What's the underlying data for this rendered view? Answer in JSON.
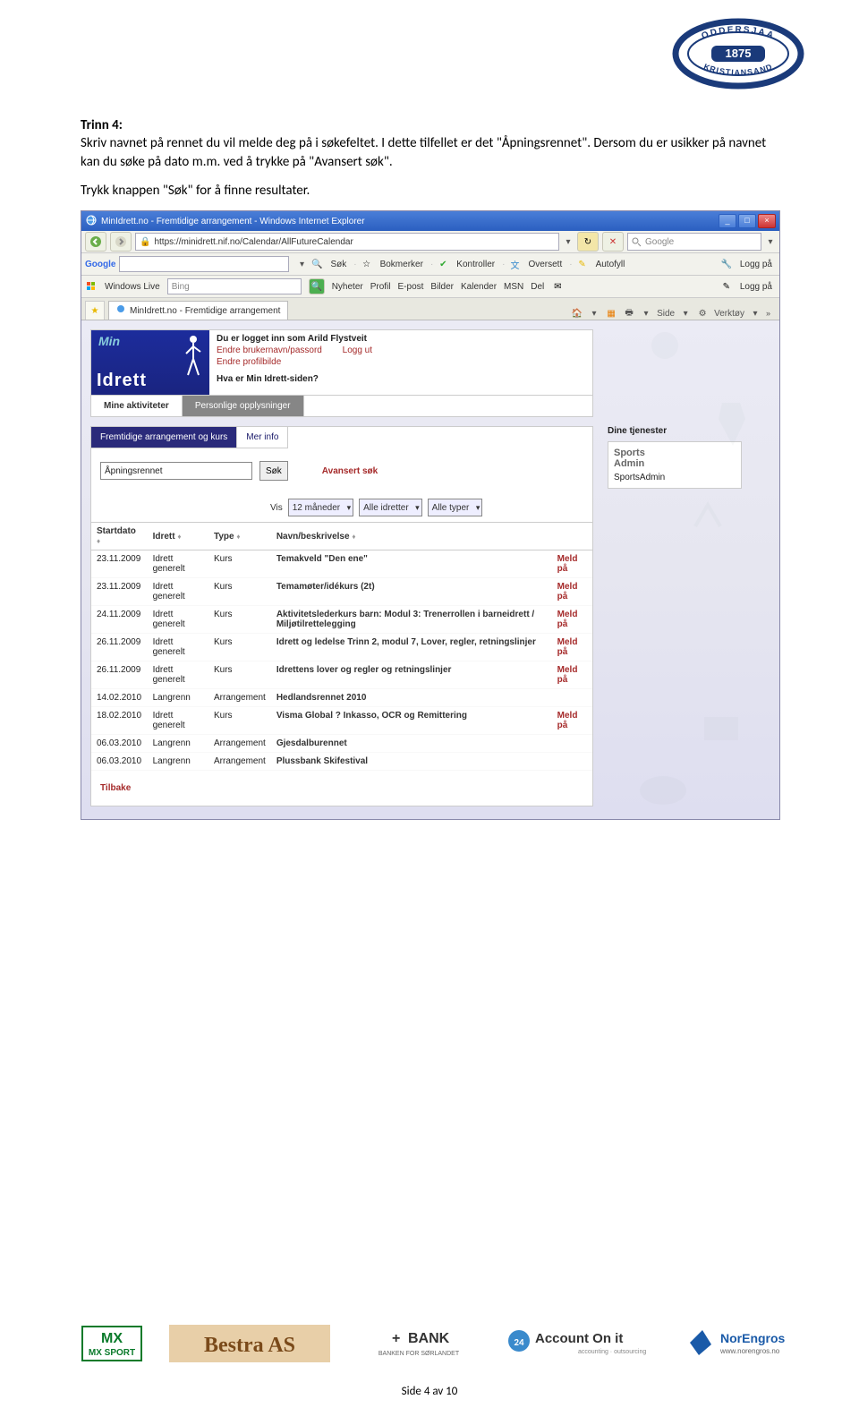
{
  "logo_top": "ODDERSJAA",
  "logo_year": "1875",
  "logo_bottom": "KRISTIANSAND",
  "heading": "Trinn 4:",
  "para1": "Skriv navnet på rennet du vil melde deg på i søkefeltet. I dette tilfellet er det \"Åpningsrennet\". Dersom du er usikker på navnet kan du søke på dato m.m. ved å trykke på \"Avansert søk\".",
  "para2": "Trykk knappen \"Søk\" for å finne resultater.",
  "ie": {
    "title": "MinIdrett.no - Fremtidige arrangement - Windows Internet Explorer",
    "url": "https://minidrett.nif.no/Calendar/AllFutureCalendar",
    "search_placeholder": "Google"
  },
  "google_bar": {
    "label": "Google",
    "btn_search": "Søk",
    "bookmarks": "Bokmerker",
    "kontroller": "Kontroller",
    "oversett": "Oversett",
    "autofyll": "Autofyll",
    "logg_pa": "Logg på"
  },
  "wl_bar": {
    "label": "Windows Live",
    "placeholder": "Bing",
    "items": [
      "Nyheter",
      "Profil",
      "E-post",
      "Bilder",
      "Kalender",
      "MSN",
      "Del"
    ],
    "logg_pa": "Logg på"
  },
  "tab_label": "MinIdrett.no - Fremtidige arrangement",
  "tabtools": {
    "side": "Side",
    "verktoy": "Verktøy"
  },
  "midrett": {
    "min": "Min",
    "idrett": "Idrett",
    "logged_in": "Du er logget inn som Arild Flystveit",
    "change_user": "Endre brukernavn/passord",
    "logout": "Logg ut",
    "change_pic": "Endre profilbilde",
    "what": "Hva er Min Idrett-siden?",
    "tab_active": "Mine aktiviteter",
    "tab_other": "Personlige opplysninger"
  },
  "side": {
    "dine": "Dine tjenester",
    "sa_brand": "Sports",
    "sa_brand2": "Admin",
    "sa_text": "SportsAdmin"
  },
  "subtabs": {
    "active": "Fremtidige arrangement og kurs",
    "other": "Mer info"
  },
  "search": {
    "value": "Åpningsrennet",
    "btn": "Søk",
    "advanced": "Avansert søk"
  },
  "filters": {
    "vis": "Vis",
    "months": "12 måneder",
    "idrett": "Alle idretter",
    "type": "Alle typer"
  },
  "table": {
    "headers": [
      "Startdato",
      "Idrett",
      "Type",
      "Navn/beskrivelse",
      ""
    ],
    "meld": "Meld på",
    "rows": [
      {
        "date": "23.11.2009",
        "idrett": "Idrett generelt",
        "type": "Kurs",
        "name": "Temakveld \"Den ene\"",
        "meld": true
      },
      {
        "date": "23.11.2009",
        "idrett": "Idrett generelt",
        "type": "Kurs",
        "name": "Temamøter/idékurs (2t)",
        "meld": true
      },
      {
        "date": "24.11.2009",
        "idrett": "Idrett generelt",
        "type": "Kurs",
        "name": "Aktivitetslederkurs barn: Modul 3: Trenerrollen i barneidrett / Miljøtilrettelegging",
        "meld": true
      },
      {
        "date": "26.11.2009",
        "idrett": "Idrett generelt",
        "type": "Kurs",
        "name": "Idrett og ledelse Trinn 2, modul 7, Lover, regler, retningslinjer",
        "meld": true
      },
      {
        "date": "26.11.2009",
        "idrett": "Idrett generelt",
        "type": "Kurs",
        "name": "Idrettens lover og regler og retningslinjer",
        "meld": true
      },
      {
        "date": "14.02.2010",
        "idrett": "Langrenn",
        "type": "Arrangement",
        "name": "Hedlandsrennet 2010",
        "meld": false
      },
      {
        "date": "18.02.2010",
        "idrett": "Idrett generelt",
        "type": "Kurs",
        "name": "Visma Global ? Inkasso, OCR og Remittering",
        "meld": true
      },
      {
        "date": "06.03.2010",
        "idrett": "Langrenn",
        "type": "Arrangement",
        "name": "Gjesdalburennet",
        "meld": false
      },
      {
        "date": "06.03.2010",
        "idrett": "Langrenn",
        "type": "Arrangement",
        "name": "Plussbank Skifestival",
        "meld": false
      }
    ]
  },
  "tilbake": "Tilbake",
  "sponsors": {
    "mx": "MX SPORT",
    "bestra": "Bestra AS",
    "bank": "BANK",
    "bank_sub": "BANKEN FOR SØRLANDET",
    "account": "Account On it",
    "account_sub": "accounting · outsourcing",
    "norengros": "NorEngros",
    "norengros_sub": "www.norengros.no"
  },
  "footer": "Side 4 av 10"
}
